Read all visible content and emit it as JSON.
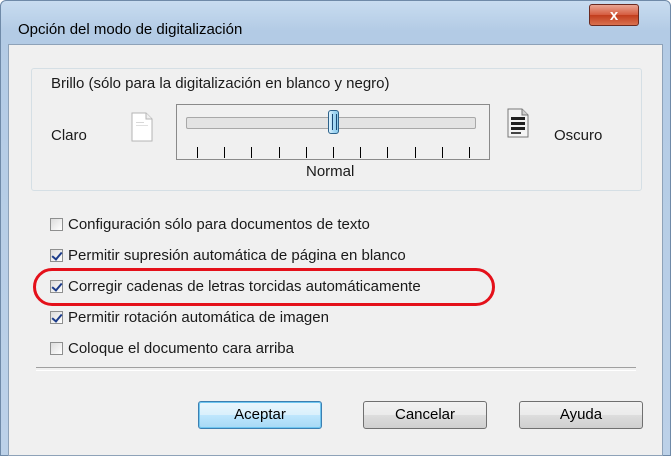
{
  "dialog": {
    "title": "Opción del modo de digitalización",
    "close_glyph": "x"
  },
  "brightness": {
    "group_title": "Brillo (sólo para la digitalización en blanco y negro)",
    "left_label": "Claro",
    "right_label": "Oscuro",
    "center_label": "Normal",
    "slider_level_fraction": 0.5,
    "left_icon": "light-page-icon",
    "right_icon": "dark-page-icon"
  },
  "options": [
    {
      "label": "Configuración sólo para documentos de texto",
      "checked": false
    },
    {
      "label": "Permitir supresión automática de página en blanco",
      "checked": true
    },
    {
      "label": "Corregir cadenas de letras torcidas automáticamente",
      "checked": true
    },
    {
      "label": "Permitir rotación automática de imagen",
      "checked": true
    },
    {
      "label": "Coloque el documento cara arriba",
      "checked": false
    }
  ],
  "buttons": {
    "ok": "Aceptar",
    "cancel": "Cancelar",
    "help": "Ayuda"
  },
  "colors": {
    "highlight": "#e4101a",
    "close_button": "#c23d1d",
    "default_button_border": "#3c7fb1"
  }
}
